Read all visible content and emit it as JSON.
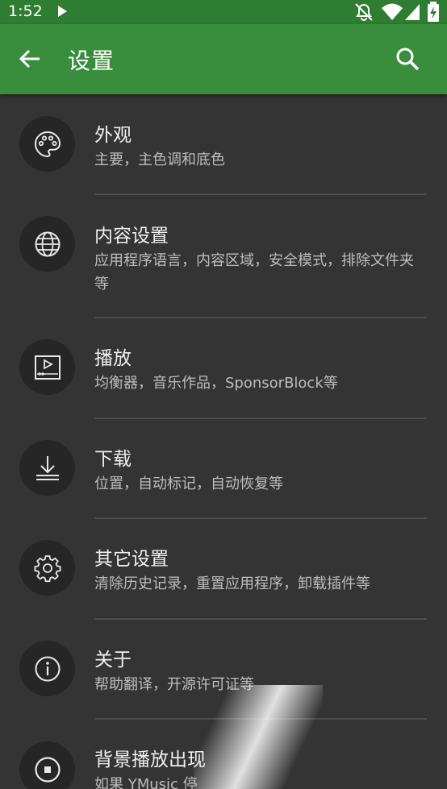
{
  "status_bar": {
    "time": "1:52",
    "icons": [
      "play-icon",
      "notifications-off-icon",
      "wifi-icon",
      "cell-signal-icon",
      "battery-charging-icon"
    ]
  },
  "app_bar": {
    "title": "设置",
    "back_icon": "arrow-back-icon",
    "search_icon": "search-icon",
    "background": "#388e3c",
    "status_background": "#2e7d32"
  },
  "settings": [
    {
      "title": "外观",
      "subtitle": "主要，主色调和底色",
      "icon": "palette-icon"
    },
    {
      "title": "内容设置",
      "subtitle": "应用程序语言，内容区域，安全模式，排除文件夹等",
      "icon": "globe-icon"
    },
    {
      "title": "播放",
      "subtitle": "均衡器，音乐作品，SponsorBlock等",
      "icon": "playback-icon"
    },
    {
      "title": "下载",
      "subtitle": "位置，自动标记，自动恢复等",
      "icon": "download-icon"
    },
    {
      "title": "其它设置",
      "subtitle": "清除历史记录，重置应用程序，卸载插件等",
      "icon": "gear-icon"
    },
    {
      "title": "关于",
      "subtitle": "帮助翻译，开源许可证等",
      "icon": "info-icon"
    },
    {
      "title": "背景播放出现",
      "subtitle": "如果 YMusic 停",
      "icon": "stop-circle-icon"
    }
  ],
  "colors": {
    "background": "#343434",
    "icon_circle": "#262626",
    "title": "#f0f0f0",
    "subtitle": "#bdbdbd",
    "divider": "#4d4d4d"
  }
}
